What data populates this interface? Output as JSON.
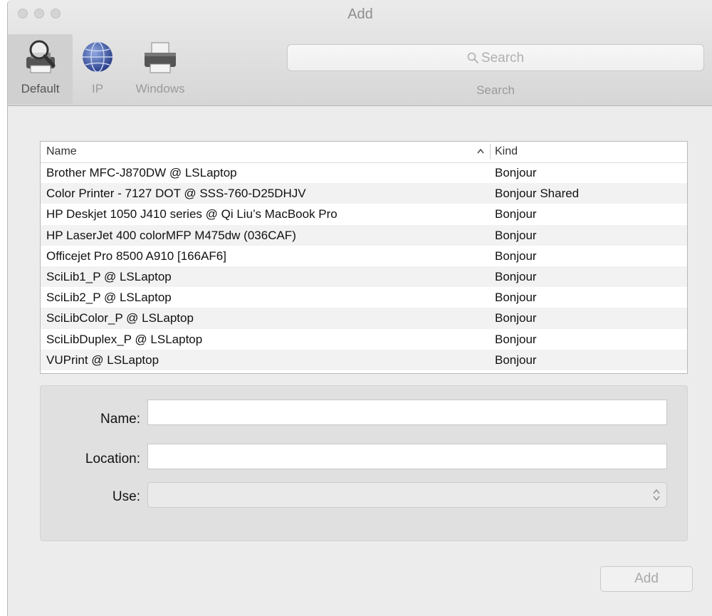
{
  "window": {
    "title": "Add"
  },
  "toolbar": {
    "items": [
      {
        "label": "Default",
        "icon": "default-printer-magnifier-icon",
        "selected": true
      },
      {
        "label": "IP",
        "icon": "globe-network-icon",
        "selected": false
      },
      {
        "label": "Windows",
        "icon": "printer-icon",
        "selected": false
      }
    ],
    "search": {
      "placeholder": "Search",
      "label": "Search",
      "icon": "search-icon"
    }
  },
  "table": {
    "columns": [
      "Name",
      "Kind"
    ],
    "sort_indicator": "^",
    "rows": [
      {
        "name": "Brother MFC-J870DW @ LSLaptop",
        "kind": "Bonjour"
      },
      {
        "name": "Color Printer - 7127 DOT @ SSS-760-D25DHJV",
        "kind": "Bonjour Shared"
      },
      {
        "name": "HP Deskjet 1050 J410 series @ Qi Liu’s MacBook Pro",
        "kind": "Bonjour"
      },
      {
        "name": "HP LaserJet 400 colorMFP M475dw (036CAF)",
        "kind": "Bonjour"
      },
      {
        "name": "Officejet Pro 8500 A910 [166AF6]",
        "kind": "Bonjour"
      },
      {
        "name": "SciLib1_P @ LSLaptop",
        "kind": "Bonjour"
      },
      {
        "name": "SciLib2_P @ LSLaptop",
        "kind": "Bonjour"
      },
      {
        "name": "SciLibColor_P @ LSLaptop",
        "kind": "Bonjour"
      },
      {
        "name": "SciLibDuplex_P @ LSLaptop",
        "kind": "Bonjour"
      },
      {
        "name": "VUPrint @ LSLaptop",
        "kind": "Bonjour"
      }
    ]
  },
  "details": {
    "name_label": "Name:",
    "name_value": "",
    "location_label": "Location:",
    "location_value": "",
    "use_label": "Use:",
    "use_value": ""
  },
  "footer": {
    "add_label": "Add"
  }
}
